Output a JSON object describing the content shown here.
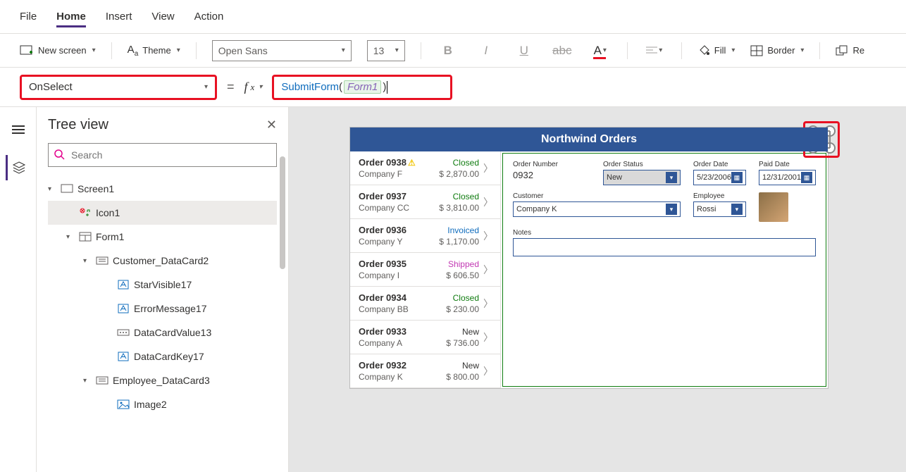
{
  "menu": {
    "file": "File",
    "home": "Home",
    "insert": "Insert",
    "view": "View",
    "action": "Action"
  },
  "ribbon": {
    "new_screen": "New screen",
    "theme": "Theme",
    "font": "Open Sans",
    "size": "13",
    "fill": "Fill",
    "border": "Border",
    "reorder": "Re"
  },
  "formula": {
    "property": "OnSelect",
    "func": "SubmitForm",
    "arg": "Form1",
    "open": "(",
    "close": ")"
  },
  "tree": {
    "title": "Tree view",
    "search_placeholder": "Search",
    "items": [
      {
        "label": "Screen1",
        "indent": 0,
        "caret": true,
        "icon": "screen"
      },
      {
        "label": "Icon1",
        "indent": 1,
        "caret": false,
        "icon": "icon",
        "selected": true
      },
      {
        "label": "Form1",
        "indent": 1,
        "caret": true,
        "icon": "form"
      },
      {
        "label": "Customer_DataCard2",
        "indent": 2,
        "caret": true,
        "icon": "card"
      },
      {
        "label": "StarVisible17",
        "indent": 3,
        "caret": false,
        "icon": "label"
      },
      {
        "label": "ErrorMessage17",
        "indent": 3,
        "caret": false,
        "icon": "label"
      },
      {
        "label": "DataCardValue13",
        "indent": 3,
        "caret": false,
        "icon": "input"
      },
      {
        "label": "DataCardKey17",
        "indent": 3,
        "caret": false,
        "icon": "label"
      },
      {
        "label": "Employee_DataCard3",
        "indent": 2,
        "caret": true,
        "icon": "card"
      },
      {
        "label": "Image2",
        "indent": 3,
        "caret": false,
        "icon": "image"
      }
    ]
  },
  "app": {
    "title": "Northwind Orders",
    "orders": [
      {
        "id": "Order 0938",
        "warn": true,
        "company": "Company F",
        "status": "Closed",
        "status_cls": "st-closed",
        "amount": "$ 2,870.00"
      },
      {
        "id": "Order 0937",
        "warn": false,
        "company": "Company CC",
        "status": "Closed",
        "status_cls": "st-closed",
        "amount": "$ 3,810.00"
      },
      {
        "id": "Order 0936",
        "warn": false,
        "company": "Company Y",
        "status": "Invoiced",
        "status_cls": "st-invoiced",
        "amount": "$ 1,170.00"
      },
      {
        "id": "Order 0935",
        "warn": false,
        "company": "Company I",
        "status": "Shipped",
        "status_cls": "st-shipped",
        "amount": "$ 606.50"
      },
      {
        "id": "Order 0934",
        "warn": false,
        "company": "Company BB",
        "status": "Closed",
        "status_cls": "st-closed",
        "amount": "$ 230.00"
      },
      {
        "id": "Order 0933",
        "warn": false,
        "company": "Company A",
        "status": "New",
        "status_cls": "st-new",
        "amount": "$ 736.00"
      },
      {
        "id": "Order 0932",
        "warn": false,
        "company": "Company K",
        "status": "New",
        "status_cls": "st-new",
        "amount": "$ 800.00"
      }
    ],
    "form": {
      "order_number_label": "Order Number",
      "order_number": "0932",
      "order_status_label": "Order Status",
      "order_status": "New",
      "order_date_label": "Order Date",
      "order_date": "5/23/2006",
      "paid_date_label": "Paid Date",
      "paid_date": "12/31/2001",
      "customer_label": "Customer",
      "customer": "Company K",
      "employee_label": "Employee",
      "employee": "Rossi",
      "notes_label": "Notes"
    }
  }
}
